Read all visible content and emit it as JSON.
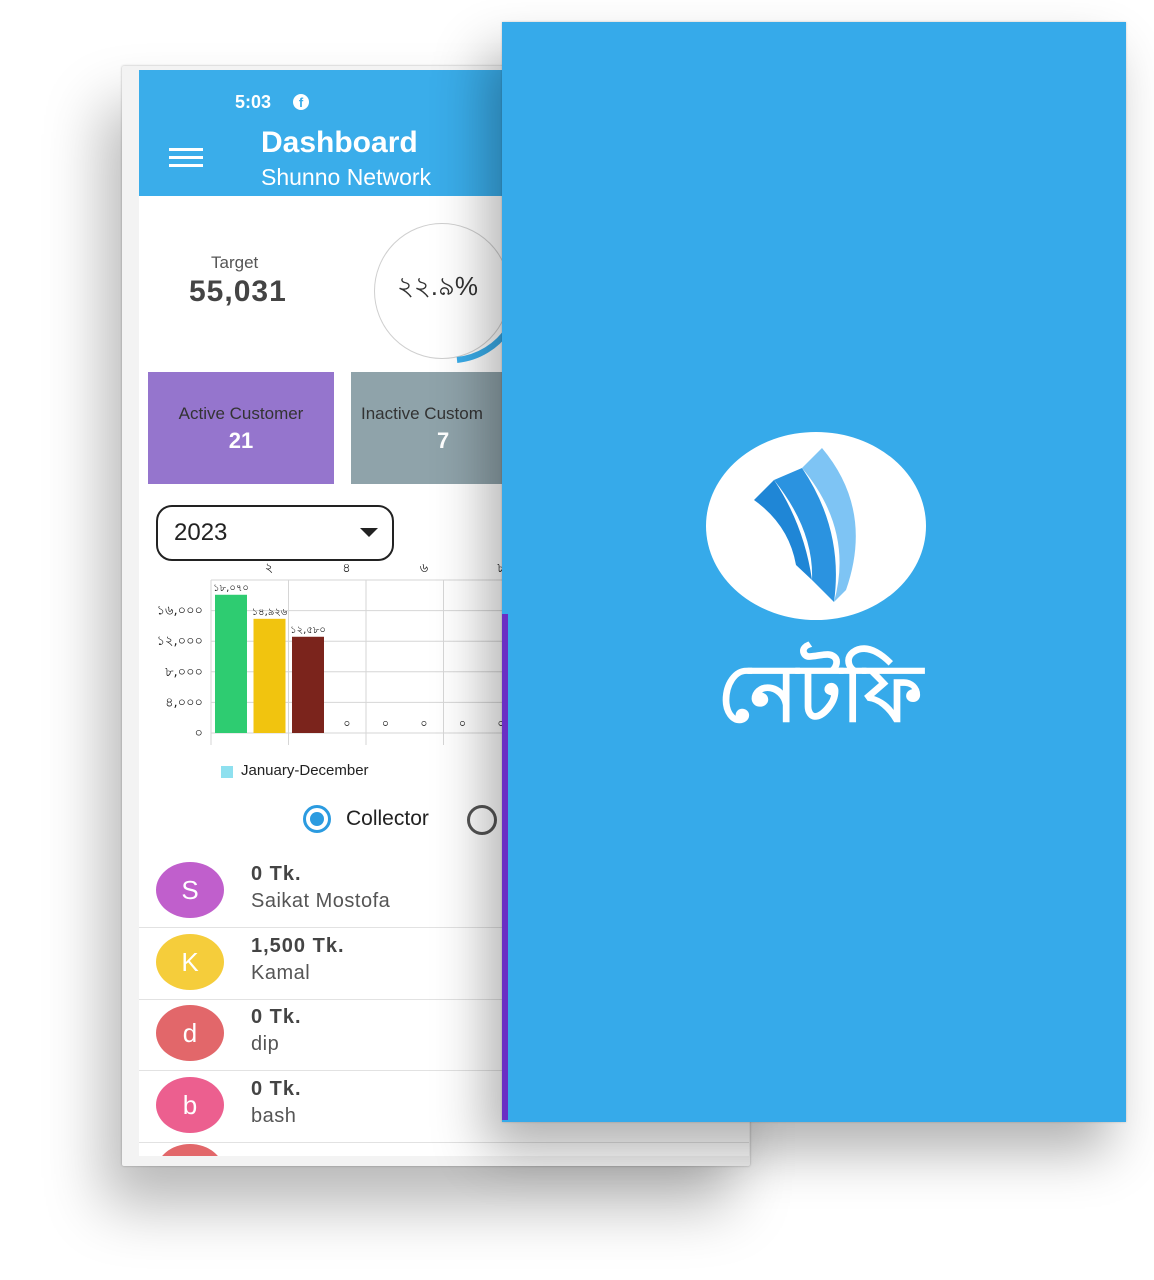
{
  "status_bar": {
    "time": "5:03",
    "notification_icon": "facebook-icon"
  },
  "appbar": {
    "title": "Dashboard",
    "subtitle": "Shunno Network",
    "menu_icon": "hamburger-menu-icon"
  },
  "target": {
    "label": "Target",
    "value": "55,031"
  },
  "progress": {
    "percent_text": "২২.৯%",
    "percent": 22.9
  },
  "cards": {
    "active": {
      "label": "Active Customer",
      "value": "21"
    },
    "inactive": {
      "label": "Inactive Custom",
      "value": "7"
    }
  },
  "year_select": {
    "value": "2023"
  },
  "chart_data": {
    "type": "bar",
    "x_tick_labels": [
      "২",
      "৪",
      "৬",
      "৮"
    ],
    "y_tick_labels": [
      "১৬,০০০",
      "১২,০০০",
      "৮,০০০",
      "৪,০০০",
      "০"
    ],
    "ylim": [
      0,
      20000
    ],
    "bars": [
      {
        "value": 18070,
        "label": "১৮,০৭০",
        "color": "#2ecc71"
      },
      {
        "value": 14926,
        "label": "১৪,৯২৬",
        "color": "#f1c40f"
      },
      {
        "value": 12580,
        "label": "১২,৫৮০",
        "color": "#7b241c"
      }
    ],
    "zero_labels": [
      "০",
      "০",
      "০",
      "০",
      "০"
    ],
    "legend": "January-December",
    "legend_color": "#8ee0ef",
    "grid": true
  },
  "radio": {
    "selected_label": "Collector"
  },
  "collectors": [
    {
      "initial": "S",
      "amount": "0  Tk.",
      "name": "Saikat Mostofa",
      "color": "#c05fcc"
    },
    {
      "initial": "K",
      "amount": "1,500  Tk.",
      "name": "Kamal",
      "color": "#f5cd3b"
    },
    {
      "initial": "d",
      "amount": "0  Tk.",
      "name": "dip",
      "color": "#e2676a"
    },
    {
      "initial": "b",
      "amount": "0  Tk.",
      "name": "bash",
      "color": "#ec5f8f"
    }
  ],
  "splash": {
    "brand": "নেটফি",
    "background": "#36aaea",
    "logo_icon": "wifi-signal-logo-icon"
  }
}
